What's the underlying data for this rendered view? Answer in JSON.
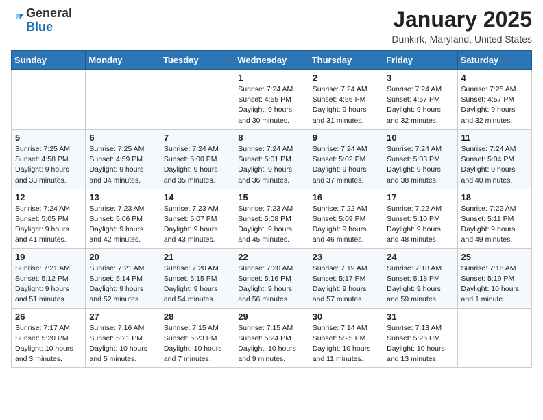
{
  "logo": {
    "general": "General",
    "blue": "Blue"
  },
  "header": {
    "month": "January 2025",
    "location": "Dunkirk, Maryland, United States"
  },
  "weekdays": [
    "Sunday",
    "Monday",
    "Tuesday",
    "Wednesday",
    "Thursday",
    "Friday",
    "Saturday"
  ],
  "weeks": [
    [
      {
        "day": "",
        "info": ""
      },
      {
        "day": "",
        "info": ""
      },
      {
        "day": "",
        "info": ""
      },
      {
        "day": "1",
        "info": "Sunrise: 7:24 AM\nSunset: 4:55 PM\nDaylight: 9 hours and 30 minutes."
      },
      {
        "day": "2",
        "info": "Sunrise: 7:24 AM\nSunset: 4:56 PM\nDaylight: 9 hours and 31 minutes."
      },
      {
        "day": "3",
        "info": "Sunrise: 7:24 AM\nSunset: 4:57 PM\nDaylight: 9 hours and 32 minutes."
      },
      {
        "day": "4",
        "info": "Sunrise: 7:25 AM\nSunset: 4:57 PM\nDaylight: 9 hours and 32 minutes."
      }
    ],
    [
      {
        "day": "5",
        "info": "Sunrise: 7:25 AM\nSunset: 4:58 PM\nDaylight: 9 hours and 33 minutes."
      },
      {
        "day": "6",
        "info": "Sunrise: 7:25 AM\nSunset: 4:59 PM\nDaylight: 9 hours and 34 minutes."
      },
      {
        "day": "7",
        "info": "Sunrise: 7:24 AM\nSunset: 5:00 PM\nDaylight: 9 hours and 35 minutes."
      },
      {
        "day": "8",
        "info": "Sunrise: 7:24 AM\nSunset: 5:01 PM\nDaylight: 9 hours and 36 minutes."
      },
      {
        "day": "9",
        "info": "Sunrise: 7:24 AM\nSunset: 5:02 PM\nDaylight: 9 hours and 37 minutes."
      },
      {
        "day": "10",
        "info": "Sunrise: 7:24 AM\nSunset: 5:03 PM\nDaylight: 9 hours and 38 minutes."
      },
      {
        "day": "11",
        "info": "Sunrise: 7:24 AM\nSunset: 5:04 PM\nDaylight: 9 hours and 40 minutes."
      }
    ],
    [
      {
        "day": "12",
        "info": "Sunrise: 7:24 AM\nSunset: 5:05 PM\nDaylight: 9 hours and 41 minutes."
      },
      {
        "day": "13",
        "info": "Sunrise: 7:23 AM\nSunset: 5:06 PM\nDaylight: 9 hours and 42 minutes."
      },
      {
        "day": "14",
        "info": "Sunrise: 7:23 AM\nSunset: 5:07 PM\nDaylight: 9 hours and 43 minutes."
      },
      {
        "day": "15",
        "info": "Sunrise: 7:23 AM\nSunset: 5:08 PM\nDaylight: 9 hours and 45 minutes."
      },
      {
        "day": "16",
        "info": "Sunrise: 7:22 AM\nSunset: 5:09 PM\nDaylight: 9 hours and 46 minutes."
      },
      {
        "day": "17",
        "info": "Sunrise: 7:22 AM\nSunset: 5:10 PM\nDaylight: 9 hours and 48 minutes."
      },
      {
        "day": "18",
        "info": "Sunrise: 7:22 AM\nSunset: 5:11 PM\nDaylight: 9 hours and 49 minutes."
      }
    ],
    [
      {
        "day": "19",
        "info": "Sunrise: 7:21 AM\nSunset: 5:12 PM\nDaylight: 9 hours and 51 minutes."
      },
      {
        "day": "20",
        "info": "Sunrise: 7:21 AM\nSunset: 5:14 PM\nDaylight: 9 hours and 52 minutes."
      },
      {
        "day": "21",
        "info": "Sunrise: 7:20 AM\nSunset: 5:15 PM\nDaylight: 9 hours and 54 minutes."
      },
      {
        "day": "22",
        "info": "Sunrise: 7:20 AM\nSunset: 5:16 PM\nDaylight: 9 hours and 56 minutes."
      },
      {
        "day": "23",
        "info": "Sunrise: 7:19 AM\nSunset: 5:17 PM\nDaylight: 9 hours and 57 minutes."
      },
      {
        "day": "24",
        "info": "Sunrise: 7:18 AM\nSunset: 5:18 PM\nDaylight: 9 hours and 59 minutes."
      },
      {
        "day": "25",
        "info": "Sunrise: 7:18 AM\nSunset: 5:19 PM\nDaylight: 10 hours and 1 minute."
      }
    ],
    [
      {
        "day": "26",
        "info": "Sunrise: 7:17 AM\nSunset: 5:20 PM\nDaylight: 10 hours and 3 minutes."
      },
      {
        "day": "27",
        "info": "Sunrise: 7:16 AM\nSunset: 5:21 PM\nDaylight: 10 hours and 5 minutes."
      },
      {
        "day": "28",
        "info": "Sunrise: 7:15 AM\nSunset: 5:23 PM\nDaylight: 10 hours and 7 minutes."
      },
      {
        "day": "29",
        "info": "Sunrise: 7:15 AM\nSunset: 5:24 PM\nDaylight: 10 hours and 9 minutes."
      },
      {
        "day": "30",
        "info": "Sunrise: 7:14 AM\nSunset: 5:25 PM\nDaylight: 10 hours and 11 minutes."
      },
      {
        "day": "31",
        "info": "Sunrise: 7:13 AM\nSunset: 5:26 PM\nDaylight: 10 hours and 13 minutes."
      },
      {
        "day": "",
        "info": ""
      }
    ]
  ]
}
